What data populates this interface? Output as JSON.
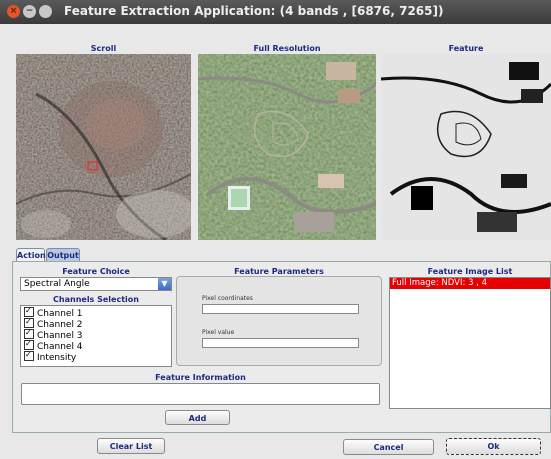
{
  "window": {
    "title": "Feature Extraction Application:  (4 bands , [6876, 7265])",
    "close_glyph": "×",
    "minimize_glyph": "−"
  },
  "panes": {
    "scroll": "Scroll",
    "full_resolution": "Full Resolution",
    "feature": "Feature"
  },
  "tabs": [
    {
      "label": "Action",
      "active": true
    },
    {
      "label": "Output",
      "active": false
    }
  ],
  "action": {
    "feature_choice_title": "Feature Choice",
    "feature_choice_value": "Spectral Angle",
    "channels_title": "Channels Selection",
    "channels": [
      {
        "label": "Channel 1",
        "checked": true
      },
      {
        "label": "Channel 2",
        "checked": true
      },
      {
        "label": "Channel 3",
        "checked": true
      },
      {
        "label": "Channel 4",
        "checked": true
      },
      {
        "label": "Intensity",
        "checked": true
      }
    ],
    "params_title": "Feature Parameters",
    "pixel_coordinates_label": "Pixel coordinates",
    "pixel_coordinates_value": "",
    "pixel_value_label": "Pixel value",
    "pixel_value_value": "",
    "info_title": "Feature Information",
    "info_value": "",
    "add_label": "Add",
    "image_list_title": "Feature Image List",
    "image_list": [
      "Full Image: NDVI: 3 , 4"
    ]
  },
  "footer": {
    "clear_list": "Clear List",
    "cancel": "Cancel",
    "ok": "Ok"
  },
  "colors": {
    "accent_text": "#1e2a80",
    "selected_item": "#e60000"
  }
}
